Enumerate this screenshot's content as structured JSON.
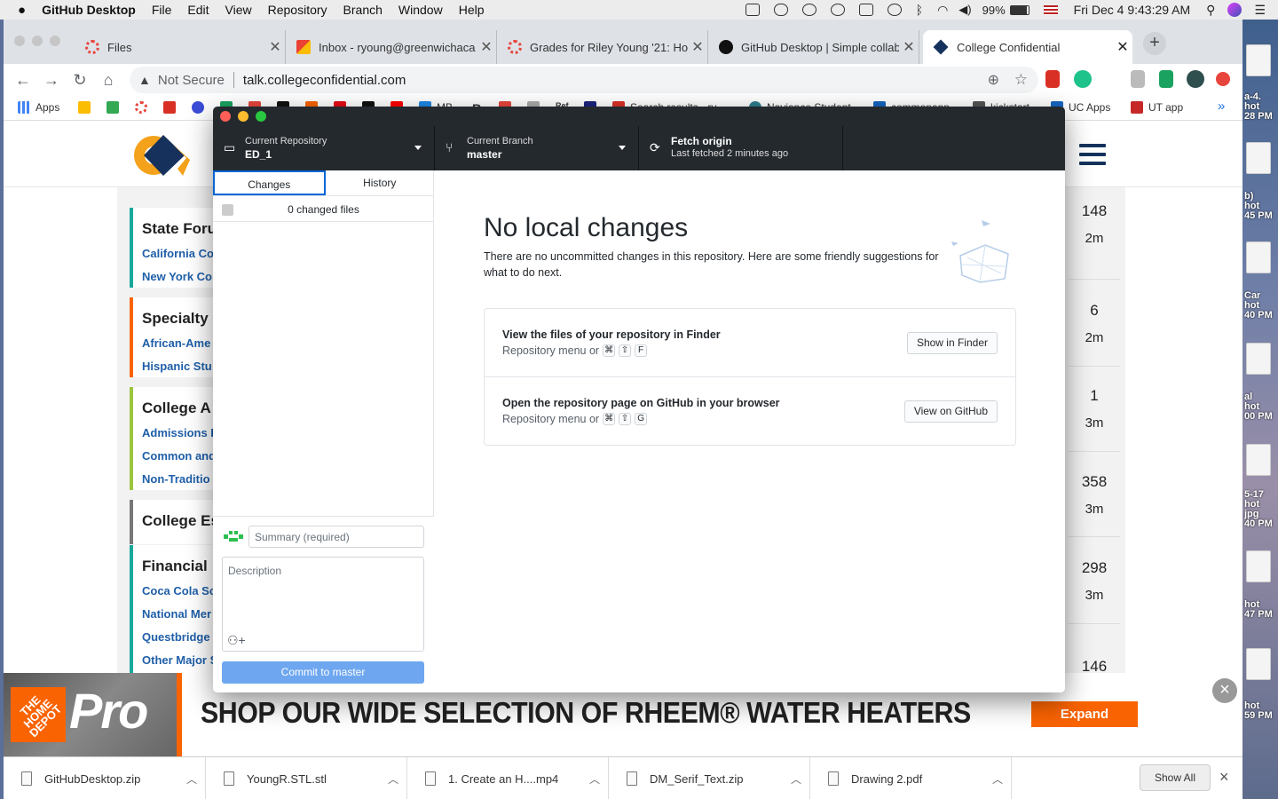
{
  "menubar": {
    "apple": "",
    "app": "GitHub Desktop",
    "items": [
      "File",
      "Edit",
      "View",
      "Repository",
      "Branch",
      "Window",
      "Help"
    ],
    "battery": "99%",
    "datetime": "Fri Dec 4  9:43:29 AM"
  },
  "desktop": {
    "labels": [
      "a-4.\nhot\n28 PM",
      "b)\nhot\n45 PM",
      "Car\nhot\n40 PM",
      "al\nhot\n00 PM",
      "5-17\nhot\njpg\n40 PM",
      "hot\n47 PM",
      "hot\n59 PM"
    ]
  },
  "browser": {
    "tabs": [
      {
        "title": "Files",
        "favicon": "red-ring",
        "color": "#e8453c"
      },
      {
        "title": "Inbox - ryoung@greenwichaca",
        "favicon": "gmail",
        "color": "#d93025"
      },
      {
        "title": "Grades for Riley Young '21: Ho",
        "favicon": "red-ring",
        "color": "#e8453c"
      },
      {
        "title": "GitHub Desktop | Simple collab",
        "favicon": "github",
        "color": "#111111"
      },
      {
        "title": "College Confidential",
        "favicon": "cc",
        "color": "#16325c"
      }
    ],
    "address": {
      "warning": "Not Secure",
      "url": "talk.collegeconfidential.com"
    },
    "bookmarks": [
      {
        "label": "Apps",
        "color": "#4285f4"
      },
      {
        "label": "",
        "color": "#fbbc04"
      },
      {
        "label": "",
        "color": "#34a853"
      },
      {
        "label": "",
        "color": "#e8453c"
      },
      {
        "label": "",
        "color": "#d93025"
      },
      {
        "label": "",
        "color": "#3b4dd8"
      },
      {
        "label": "",
        "color": "#1aa260"
      },
      {
        "label": "",
        "color": "#e8453c"
      },
      {
        "label": "",
        "color": "#111111"
      },
      {
        "label": "",
        "color": "#f96302"
      },
      {
        "label": "",
        "color": "#e50914"
      },
      {
        "label": "",
        "color": "#111111"
      },
      {
        "label": "",
        "color": "#ff0000"
      },
      {
        "label": "MB",
        "color": "#1e88e5"
      },
      {
        "label": "R",
        "color": "#222222"
      },
      {
        "label": "",
        "color": "#e8453c"
      },
      {
        "label": "",
        "color": "#777777"
      },
      {
        "label": "Ref",
        "color": "#333333"
      },
      {
        "label": "",
        "color": "#1a237e"
      },
      {
        "label": "Search results - ry...",
        "color": "#d93025"
      },
      {
        "label": "Naviance Student",
        "color": "#2e7d8c"
      },
      {
        "label": "commonapp",
        "color": "#1565c0"
      },
      {
        "label": "kickstart",
        "color": "#555555"
      },
      {
        "label": "UC Apps",
        "color": "#1565c0"
      },
      {
        "label": "UT app",
        "color": "#c62828"
      }
    ],
    "bookmarks_more": "»"
  },
  "site": {
    "forums": [
      {
        "title": "State Foru",
        "color": "#18a99a",
        "links": [
          "California Co",
          "New York Co"
        ]
      },
      {
        "title": "Specialty",
        "color": "#f96302",
        "links": [
          "African-Ame",
          "Hispanic Stu"
        ]
      },
      {
        "title": "College A",
        "color": "#9bc53d",
        "links": [
          "Admissions H",
          "Common and",
          "Non-Traditio"
        ]
      },
      {
        "title": "College Es",
        "color": "#777777",
        "links": []
      },
      {
        "title": "Financial",
        "color": "#18a99a",
        "links": [
          "Coca Cola Sc",
          "National Mer",
          "Questbridge",
          "Other Major S"
        ]
      }
    ],
    "stats": [
      {
        "n": "148",
        "t": "2m"
      },
      {
        "n": "6",
        "t": "2m"
      },
      {
        "n": "1",
        "t": "3m"
      },
      {
        "n": "358",
        "t": "3m"
      },
      {
        "n": "298",
        "t": "3m"
      },
      {
        "n": "146",
        "t": ""
      }
    ]
  },
  "ad": {
    "brand": "Pro",
    "brand_small": "THE HOME DEPOT",
    "headline": "SHOP OUR WIDE SELECTION OF RHEEM® WATER HEATERS",
    "cta": "Expand",
    "close": "×"
  },
  "downloads": {
    "items": [
      "GitHubDesktop.zip",
      "YoungR.STL.stl",
      "1. Create an H....mp4",
      "DM_Serif_Text.zip",
      "Drawing 2.pdf"
    ],
    "show_all": "Show All",
    "close": "×"
  },
  "github_desktop": {
    "repo": {
      "label": "Current Repository",
      "value": "ED_1"
    },
    "branch": {
      "label": "Current Branch",
      "value": "master"
    },
    "fetch": {
      "label": "Fetch origin",
      "value": "Last fetched 2 minutes ago"
    },
    "tabs": [
      "Changes",
      "History"
    ],
    "changed_files": "0 changed files",
    "summary_placeholder": "Summary (required)",
    "description_placeholder": "Description",
    "commit_label": "Commit to master",
    "main": {
      "title": "No local changes",
      "desc": "There are no uncommitted changes in this repository. Here are some friendly suggestions for what to do next.",
      "suggestions": [
        {
          "title": "View the files of your repository in Finder",
          "sub": "Repository menu or",
          "keys": [
            "⌘",
            "⇧",
            "F"
          ],
          "button": "Show in Finder"
        },
        {
          "title": "Open the repository page on GitHub in your browser",
          "sub": "Repository menu or",
          "keys": [
            "⌘",
            "⇧",
            "G"
          ],
          "button": "View on GitHub"
        }
      ]
    }
  }
}
